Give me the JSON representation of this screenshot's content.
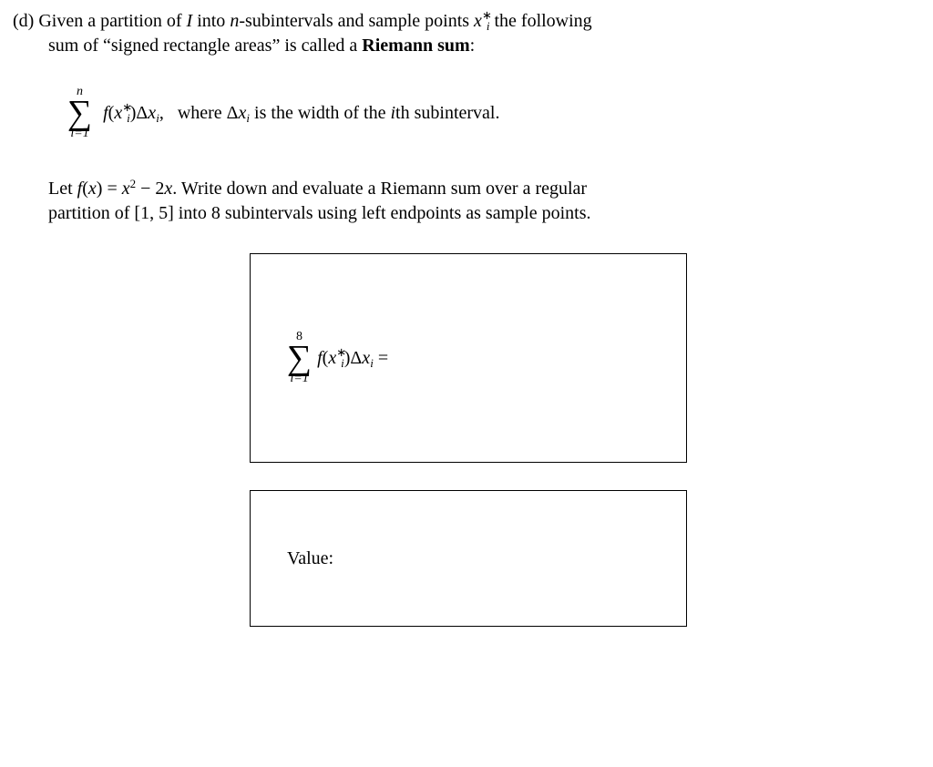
{
  "problem": {
    "label": "(d)",
    "intro_line1": "Given a partition of ",
    "intro_I": "I",
    "intro_line1b": " into ",
    "intro_n": "n",
    "intro_line1c": "-subintervals and sample points ",
    "intro_x": "x",
    "intro_star": "∗",
    "intro_i": "i",
    "intro_line1d": " the following",
    "intro_line2a": "sum of “signed rectangle areas” is called a ",
    "intro_bold": "Riemann sum",
    "intro_line2b": ":"
  },
  "definition": {
    "sigma_top": "n",
    "sigma_bottom": "i=1",
    "expr_f": "f",
    "expr_open": "(",
    "expr_x": "x",
    "expr_star": "∗",
    "expr_i1": "i",
    "expr_close": ")",
    "expr_delta": "Δ",
    "expr_x2": "x",
    "expr_i2": "i",
    "expr_comma": ",",
    "where_text": " where Δ",
    "where_x": "x",
    "where_i": "i",
    "where_text2": " is the width of the ",
    "where_ith": "i",
    "where_th": "th subinterval."
  },
  "task": {
    "let": "Let ",
    "fx": "f",
    "open": "(",
    "x": "x",
    "close": ")",
    "eq": " = ",
    "x2": "x",
    "sq": "2",
    "minus": " − 2",
    "x3": "x",
    "dot": ".",
    "text1": "  Write down and evaluate a Riemann sum over a regular",
    "text2": "partition of [1, 5] into 8 subintervals using left endpoints as sample points."
  },
  "box1": {
    "sigma_top": "8",
    "sigma_bottom": "i=1",
    "f": "f",
    "open": "(",
    "x": "x",
    "star": "∗",
    "i1": "i",
    "close": ")",
    "delta": "Δ",
    "x2": "x",
    "i2": "i",
    "eq": " ="
  },
  "box2": {
    "label": "Value:"
  }
}
